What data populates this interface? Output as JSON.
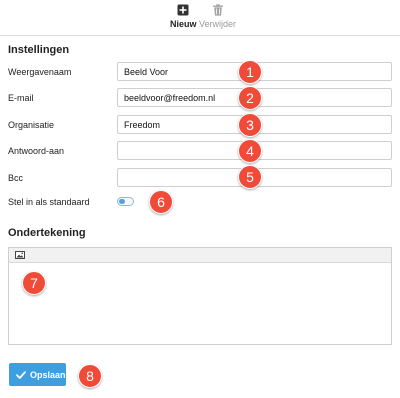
{
  "toolbar": {
    "new_label": "Nieuw",
    "new_icon": "plus-square-icon",
    "delete_label": "Verwijder",
    "delete_icon": "trash-icon"
  },
  "settings": {
    "title": "Instellingen",
    "fields": {
      "display_name": {
        "label": "Weergavenaam",
        "value": "Beeld Voor",
        "badge": "1"
      },
      "email": {
        "label": "E-mail",
        "value": "beeldvoor@freedom.nl",
        "badge": "2"
      },
      "organization": {
        "label": "Organisatie",
        "value": "Freedom",
        "badge": "3"
      },
      "reply_to": {
        "label": "Antwoord-aan",
        "value": "",
        "badge": "4"
      },
      "bcc": {
        "label": "Bcc",
        "value": "",
        "badge": "5"
      }
    },
    "default": {
      "label": "Stel in als standaard",
      "enabled": false,
      "badge": "6"
    }
  },
  "signature": {
    "title": "Ondertekening",
    "image_icon": "image-icon",
    "badge": "7"
  },
  "save": {
    "label": "Opslaan",
    "icon": "check-icon",
    "badge": "8"
  },
  "colors": {
    "accent": "#3d9ee0",
    "badge": "#ef4b38",
    "border": "#cfcfcf",
    "editor_toolbar": "#f1f1f1"
  }
}
